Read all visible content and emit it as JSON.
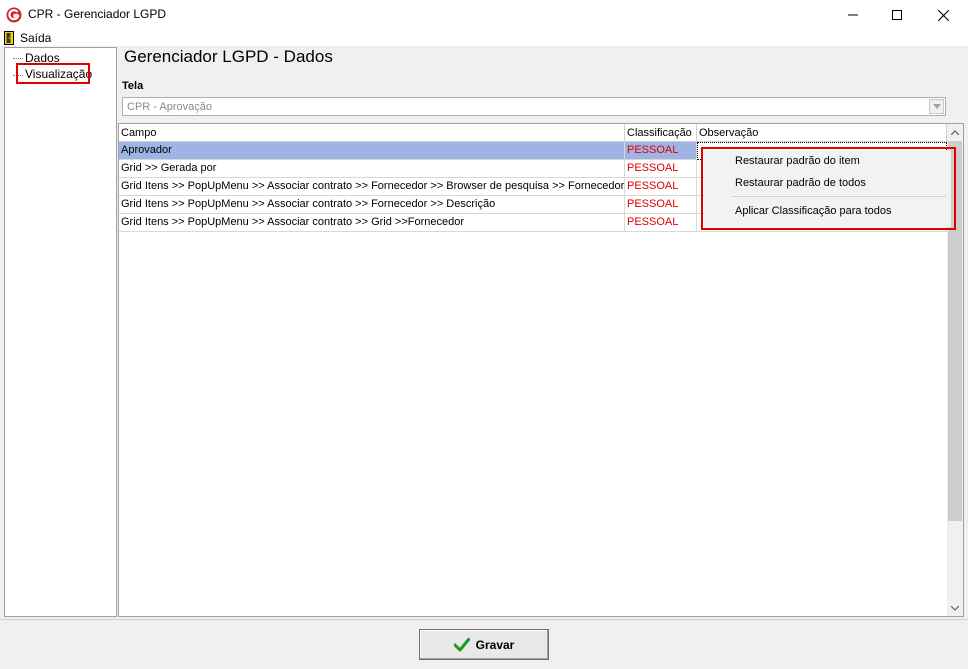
{
  "window": {
    "title": "CPR - Gerenciador LGPD"
  },
  "menu": {
    "saida_label": "Saída"
  },
  "tree": {
    "items": [
      {
        "label": "Dados"
      },
      {
        "label": "Visualização"
      }
    ]
  },
  "page": {
    "title": "Gerenciador LGPD - Dados"
  },
  "tela": {
    "label": "Tela",
    "value": "CPR - Aprovação"
  },
  "grid": {
    "columns": [
      "Campo",
      "Classificação",
      "Observação"
    ],
    "rows": [
      {
        "campo": "Aprovador",
        "classificacao": "PESSOAL",
        "observacao": ""
      },
      {
        "campo": "Grid >> Gerada por",
        "classificacao": "PESSOAL",
        "observacao": ""
      },
      {
        "campo": "Grid Itens >> PopUpMenu >> Associar contrato >> Fornecedor >> Browser de pesquisa >> Fornecedor",
        "classificacao": "PESSOAL",
        "observacao": ""
      },
      {
        "campo": "Grid Itens >> PopUpMenu >> Associar contrato >> Fornecedor >> Descrição",
        "classificacao": "PESSOAL",
        "observacao": ""
      },
      {
        "campo": "Grid Itens >> PopUpMenu >> Associar contrato >> Grid >>Fornecedor",
        "classificacao": "PESSOAL",
        "observacao": ""
      }
    ]
  },
  "context_menu": {
    "items": [
      "Restaurar padrão do item",
      "Restaurar padrão de todos",
      "Aplicar Classificação para todos"
    ]
  },
  "footer": {
    "save_label": "Gravar"
  },
  "colors": {
    "highlight_red": "#e00000",
    "selection": "#9db4e4",
    "brand_red": "#d0202a"
  }
}
